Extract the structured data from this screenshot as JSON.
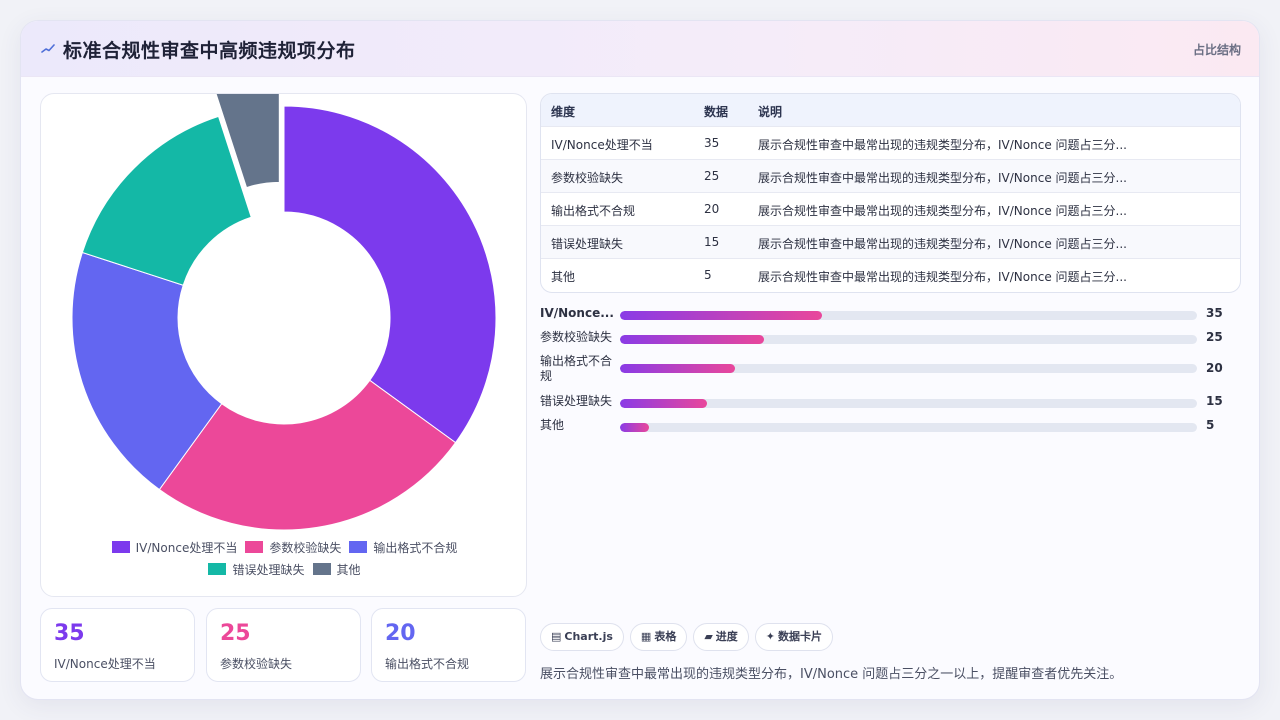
{
  "header": {
    "title": "标准合规性审查中高频违规项分布",
    "tag": "占比结构"
  },
  "chart_data": {
    "type": "pie",
    "categories": [
      "IV/Nonce处理不当",
      "参数校验缺失",
      "输出格式不合规",
      "错误处理缺失",
      "其他"
    ],
    "values": [
      35,
      25,
      20,
      15,
      5
    ],
    "colors": [
      "#7c3aed",
      "#ec4899",
      "#6366f1",
      "#14b8a6",
      "#64748b"
    ],
    "donut": true,
    "highlight_offset_slice": 4,
    "title": "",
    "legend_position": "bottom"
  },
  "kpis": [
    {
      "value": "35",
      "label": "IV/Nonce处理不当",
      "color": "#7c3aed"
    },
    {
      "value": "25",
      "label": "参数校验缺失",
      "color": "#ec4899"
    },
    {
      "value": "20",
      "label": "输出格式不合规",
      "color": "#6366f1"
    }
  ],
  "table": {
    "headers": [
      "维度",
      "数据",
      "说明"
    ],
    "rows": [
      [
        "IV/Nonce处理不当",
        "35",
        "展示合规性审查中最常出现的违规类型分布，IV/Nonce 问题占三分..."
      ],
      [
        "参数校验缺失",
        "25",
        "展示合规性审查中最常出现的违规类型分布，IV/Nonce 问题占三分..."
      ],
      [
        "输出格式不合规",
        "20",
        "展示合规性审查中最常出现的违规类型分布，IV/Nonce 问题占三分..."
      ],
      [
        "错误处理缺失",
        "15",
        "展示合规性审查中最常出现的违规类型分布，IV/Nonce 问题占三分..."
      ],
      [
        "其他",
        "5",
        "展示合规性审查中最常出现的违规类型分布，IV/Nonce 问题占三分..."
      ]
    ]
  },
  "bars": {
    "max": 100,
    "items": [
      {
        "label": "IV/Nonce...",
        "value": 35
      },
      {
        "label": "参数校验缺失",
        "value": 25
      },
      {
        "label": "输出格式不合规",
        "value": 20
      },
      {
        "label": "错误处理缺失",
        "value": 15
      },
      {
        "label": "其他",
        "value": 5
      }
    ]
  },
  "chips": [
    {
      "icon": "▤",
      "icon_name": "chart-icon",
      "label": "Chart.js"
    },
    {
      "icon": "▦",
      "icon_name": "table-icon",
      "label": "表格"
    },
    {
      "icon": "▰",
      "icon_name": "progress-icon",
      "label": "进度"
    },
    {
      "icon": "✦",
      "icon_name": "sparkle-icon",
      "label": "数据卡片"
    }
  ],
  "footnote": "展示合规性审查中最常出现的违规类型分布，IV/Nonce 问题占三分之一以上，提醒审查者优先关注。"
}
